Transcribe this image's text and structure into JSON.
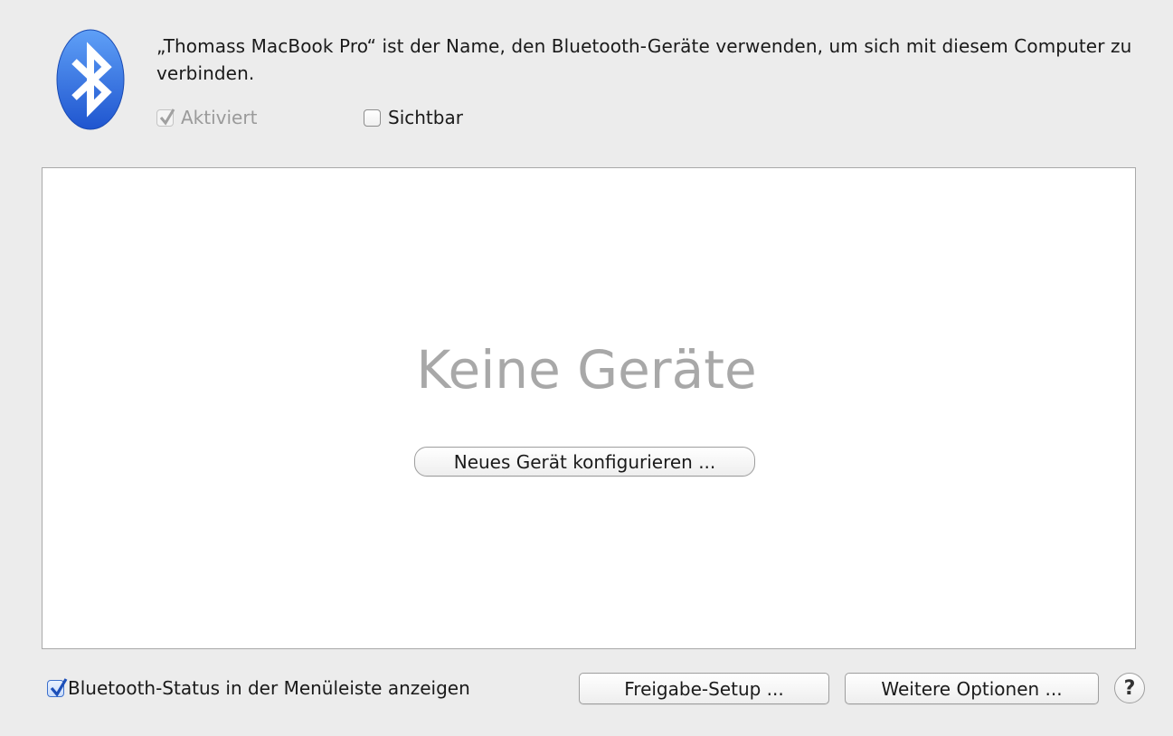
{
  "header": {
    "description": "„Thomass MacBook Pro“ ist der Name, den Bluetooth-Geräte verwenden, um sich mit diesem Computer zu verbinden.",
    "icon": "bluetooth-icon"
  },
  "options": {
    "aktiviert_label": "Aktiviert",
    "aktiviert_checked": true,
    "aktiviert_enabled": false,
    "sichtbar_label": "Sichtbar",
    "sichtbar_checked": false
  },
  "device_list": {
    "empty_text": "Keine Geräte",
    "new_device_button": "Neues Gerät konfigurieren ..."
  },
  "footer": {
    "status_label": "Bluetooth-Status in der Menüleiste anzeigen",
    "status_checked": true,
    "share_button": "Freigabe-Setup ...",
    "options_button": "Weitere Optionen ...",
    "help_label": "?"
  },
  "colors": {
    "icon_blue": "#2f6fe0",
    "window_bg": "#ececec",
    "checkmark_blue": "#1d4fb8"
  }
}
